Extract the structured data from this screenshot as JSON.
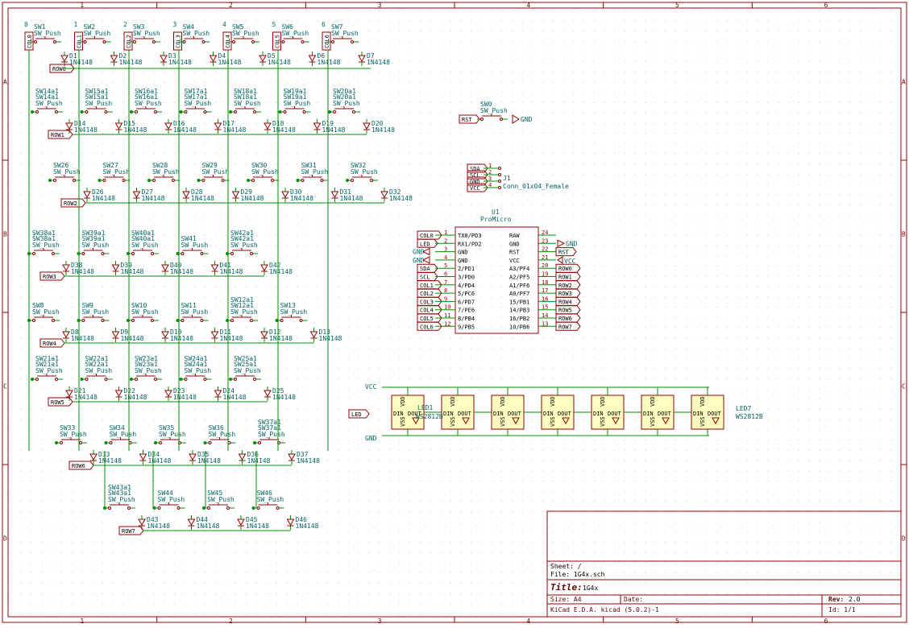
{
  "frame": {
    "col_labels": [
      "1",
      "2",
      "3",
      "4",
      "5",
      "6"
    ],
    "row_labels": [
      "A",
      "B",
      "C",
      "D"
    ]
  },
  "switches_top": [
    {
      "sw": "SW1",
      "col": "0",
      "diode": "D1"
    },
    {
      "sw": "SW2",
      "col": "1",
      "diode": "D2"
    },
    {
      "sw": "SW3",
      "col": "2",
      "diode": "D3"
    },
    {
      "sw": "SW4",
      "col": "3",
      "diode": "D4"
    },
    {
      "sw": "SW5",
      "col": "4",
      "diode": "D5"
    },
    {
      "sw": "SW6",
      "col": "5",
      "diode": "D6"
    },
    {
      "sw": "SW7",
      "col": "6",
      "diode": "D7"
    }
  ],
  "col_net_names": [
    "COL0",
    "COL1",
    "COL2",
    "COL3",
    "COL4",
    "COL5",
    "COL6"
  ],
  "row1": [
    {
      "sw": "SW14a1",
      "diode": "D14"
    },
    {
      "sw": "SW15a1",
      "diode": "D15"
    },
    {
      "sw": "SW16a1",
      "diode": "D16"
    },
    {
      "sw": "SW17a1",
      "diode": "D17"
    },
    {
      "sw": "SW18a1",
      "diode": "D18"
    },
    {
      "sw": "SW19a1",
      "diode": "D19"
    },
    {
      "sw": "SW20a1",
      "diode": "D20"
    }
  ],
  "row2": [
    {
      "sw": "SW26",
      "diode": "D26"
    },
    {
      "sw": "SW27",
      "diode": "D27"
    },
    {
      "sw": "SW28",
      "diode": "D28"
    },
    {
      "sw": "SW29",
      "diode": "D29"
    },
    {
      "sw": "SW30",
      "diode": "D30"
    },
    {
      "sw": "SW31",
      "diode": "D31"
    },
    {
      "sw": "SW32",
      "diode": "D32"
    }
  ],
  "row3": [
    {
      "sw": "SW38a1",
      "diode": "D38"
    },
    {
      "sw": "SW39a1",
      "diode": "D39"
    },
    {
      "sw": "SW40a1",
      "diode": "D40"
    },
    {
      "sw": "SW41",
      "diode": "D41"
    },
    {
      "sw": "SW42a1",
      "diode": "D42"
    }
  ],
  "row4": [
    {
      "sw": "SW8",
      "diode": "D8"
    },
    {
      "sw": "SW9",
      "diode": "D9"
    },
    {
      "sw": "SW10",
      "diode": "D10"
    },
    {
      "sw": "SW11",
      "diode": "D11"
    },
    {
      "sw": "SW12a1",
      "diode": "D12"
    },
    {
      "sw": "SW13",
      "diode": "D13"
    }
  ],
  "row5": [
    {
      "sw": "SW21a1",
      "diode": "D21"
    },
    {
      "sw": "SW22a1",
      "diode": "D22"
    },
    {
      "sw": "SW23a1",
      "diode": "D23"
    },
    {
      "sw": "SW24a1",
      "diode": "D24"
    },
    {
      "sw": "SW25a1",
      "diode": "D25"
    }
  ],
  "row6": [
    {
      "sw": "SW33",
      "diode": "D33"
    },
    {
      "sw": "SW34",
      "diode": "D34"
    },
    {
      "sw": "SW35",
      "diode": "D35"
    },
    {
      "sw": "SW36",
      "diode": "D36"
    },
    {
      "sw": "SW37a1",
      "diode": "D37"
    }
  ],
  "row7": [
    {
      "sw": "SW43a1",
      "diode": "D43"
    },
    {
      "sw": "SW44",
      "diode": "D44"
    },
    {
      "sw": "SW45",
      "diode": "D45"
    },
    {
      "sw": "SW46",
      "diode": "D46"
    }
  ],
  "row_net_names": [
    "ROW0",
    "ROW1",
    "ROW2",
    "ROW3",
    "ROW4",
    "ROW5",
    "ROW6",
    "ROW7"
  ],
  "sw_value": "SW_Push",
  "diode_value": "1N4148",
  "reset_switch": {
    "ref": "SW0",
    "value": "SW_Push",
    "net": "RST",
    "gnd": "GND"
  },
  "connector": {
    "ref": "J1",
    "value": "Conn_01x04_Female",
    "pins": [
      {
        "net": "SDA",
        "num": "1"
      },
      {
        "net": "SCL",
        "num": "2"
      },
      {
        "net": "GND",
        "num": "3"
      },
      {
        "net": "VCC",
        "num": "4"
      }
    ]
  },
  "mcu": {
    "ref": "U1",
    "value": "ProMicro",
    "left_pins": [
      {
        "net": "COL0",
        "num": "1",
        "name": "TX0/PD3"
      },
      {
        "net": "LED",
        "num": "2",
        "name": "RX1/PD2"
      },
      {
        "net": "GND",
        "num": "3",
        "name": "GND"
      },
      {
        "net": "GND",
        "num": "4",
        "name": "GND"
      },
      {
        "net": "SDA",
        "num": "5",
        "name": "2/PD1"
      },
      {
        "net": "SCL",
        "num": "6",
        "name": "3/PD0"
      },
      {
        "net": "COL1",
        "num": "7",
        "name": "4/PD4"
      },
      {
        "net": "COL2",
        "num": "8",
        "name": "5/PC6"
      },
      {
        "net": "COL3",
        "num": "9",
        "name": "6/PD7"
      },
      {
        "net": "COL4",
        "num": "10",
        "name": "7/PE6"
      },
      {
        "net": "COL5",
        "num": "11",
        "name": "8/PB4"
      },
      {
        "net": "COL6",
        "num": "12",
        "name": "9/PB5"
      }
    ],
    "right_pins": [
      {
        "net": "",
        "num": "24",
        "name": "RAW"
      },
      {
        "net": "GND",
        "num": "23",
        "name": "GND"
      },
      {
        "net": "RST",
        "num": "22",
        "name": "RST"
      },
      {
        "net": "VCC",
        "num": "21",
        "name": "VCC"
      },
      {
        "net": "ROW0",
        "num": "20",
        "name": "A3/PF4"
      },
      {
        "net": "ROW1",
        "num": "19",
        "name": "A2/PF5"
      },
      {
        "net": "ROW2",
        "num": "18",
        "name": "A1/PF6"
      },
      {
        "net": "ROW3",
        "num": "17",
        "name": "A0/PF7"
      },
      {
        "net": "ROW4",
        "num": "16",
        "name": "15/PB1"
      },
      {
        "net": "ROW5",
        "num": "15",
        "name": "14/PB3"
      },
      {
        "net": "ROW6",
        "num": "14",
        "name": "16/PB2"
      },
      {
        "net": "ROW7",
        "num": "13",
        "name": "10/PB6"
      }
    ]
  },
  "leds": {
    "first_ref": "LED1",
    "last_ref": "LED7",
    "value": "WS2812B",
    "count": 7,
    "vcc": "VCC",
    "gnd": "GND",
    "in_net": "LED",
    "pin_din": "DIN",
    "pin_dout": "DOUT",
    "pin_vdd": "VDD",
    "pin_vss": "VSS"
  },
  "title_block": {
    "sheet_label": "Sheet: /",
    "file_label": "File: 1G4x.sch",
    "title_label": "Title:",
    "title_value": "1G4x",
    "size_label": "Size: A4",
    "date_label": "Date:",
    "rev_label": "Rev:",
    "rev_value": "2.0",
    "kicad_label": "KiCad E.D.A.  kicad (5.0.2)-1",
    "id_label": "Id: 1/1"
  }
}
